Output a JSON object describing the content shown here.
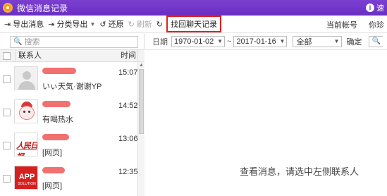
{
  "window": {
    "title": "微信消息记录",
    "right_text": "速"
  },
  "toolbar": {
    "export_messages": "导出消息",
    "export_by_category": "分类导出",
    "restore": "还原",
    "refresh": "刷新",
    "recover_chats": "找回聊天记录",
    "current_account_label": "当前帐号",
    "current_account_value": "你珍"
  },
  "search": {
    "placeholder": "搜索"
  },
  "list": {
    "header_contact": "联系人",
    "header_time": "时间",
    "rows": [
      {
        "preview": "いぃ天気·谢谢YP",
        "time": "15:07"
      },
      {
        "preview": "有喝热水",
        "time": "14:52"
      },
      {
        "preview": "[网页]",
        "time": "13:06"
      },
      {
        "preview": "[网页]",
        "time": "12:35"
      }
    ],
    "avatars": {
      "news_logo": "人民日报",
      "app_logo": "APP",
      "app_sub": "SOLUTION"
    }
  },
  "filter": {
    "date_label": "日期",
    "start_date": "1970-01-02",
    "separator": "~",
    "end_date": "2017-01-16",
    "type_value": "全部",
    "confirm_label": "确定"
  },
  "empty_message": "查看消息，请选中左侧联系人",
  "colors": {
    "titlebar": "#6a2fc2",
    "highlight": "#e02020",
    "redaction": "#f06262"
  }
}
